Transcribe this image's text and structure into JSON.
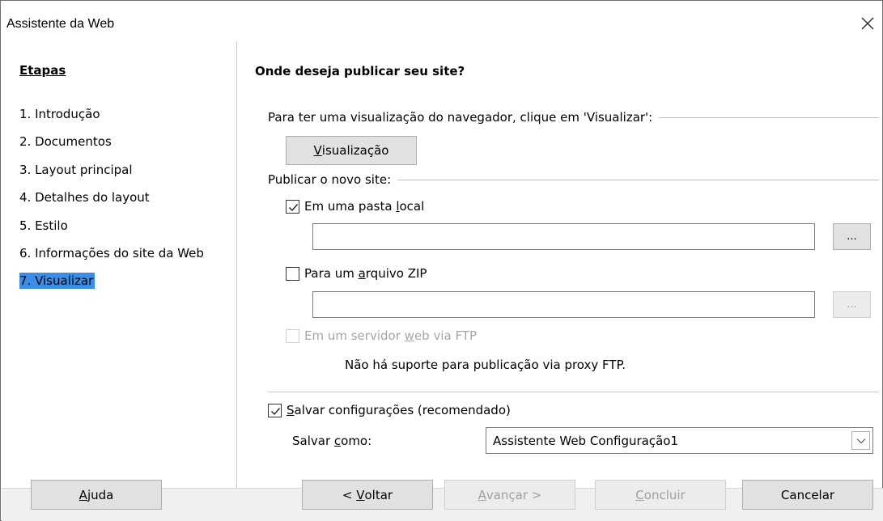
{
  "window": {
    "title": "Assistente da Web",
    "close_icon": "close-icon"
  },
  "sidebar": {
    "heading": "Etapas",
    "steps": [
      {
        "label": "1. Introdução",
        "active": false
      },
      {
        "label": "2. Documentos",
        "active": false
      },
      {
        "label": "3. Layout principal",
        "active": false
      },
      {
        "label": "4. Detalhes do layout",
        "active": false
      },
      {
        "label": "5. Estilo",
        "active": false
      },
      {
        "label": "6. Informações do site da Web",
        "active": false
      },
      {
        "label": "7. Visualizar",
        "active": true
      }
    ]
  },
  "main": {
    "title": "Onde deseja publicar seu site?",
    "preview_section_label": "Para ter uma visualização do navegador, clique em 'Visualizar':",
    "preview_button": {
      "prefix": "",
      "mnemonic": "V",
      "rest": "isualização"
    },
    "publish_section_label": "Publicar o novo site:",
    "local_folder": {
      "checked": true,
      "label_pre": "Em uma pasta ",
      "mnemonic": "l",
      "label_post": "ocal",
      "path_value": "",
      "browse_label": "..."
    },
    "zip_file": {
      "checked": false,
      "label_pre": "Para um ",
      "mnemonic": "a",
      "label_post": "rquivo ZIP",
      "path_value": "",
      "browse_label": "..."
    },
    "ftp": {
      "checked": false,
      "disabled": true,
      "label_pre": "Em um servidor ",
      "mnemonic": "w",
      "label_post": "eb via FTP"
    },
    "ftp_note": "Não há suporte para publicação via proxy FTP.",
    "save_settings": {
      "checked": true,
      "mnemonic": "S",
      "label_post": "alvar configurações (recomendado)"
    },
    "save_as": {
      "label_pre": "Salvar ",
      "mnemonic": "c",
      "label_post": "omo:",
      "selected": "Assistente Web Configuração1"
    }
  },
  "footer": {
    "help": {
      "mnemonic": "A",
      "rest": "juda"
    },
    "back": {
      "prefix": "< ",
      "mnemonic": "V",
      "rest": "oltar"
    },
    "next": {
      "prefix": "",
      "mnemonic": "A",
      "rest": "vançar >"
    },
    "finish": {
      "prefix": "",
      "mnemonic": "C",
      "rest": "oncluir"
    },
    "cancel": "Cancelar"
  },
  "colors": {
    "selection": "#3a8ee6",
    "disabled_text": "#a0a0a0"
  }
}
